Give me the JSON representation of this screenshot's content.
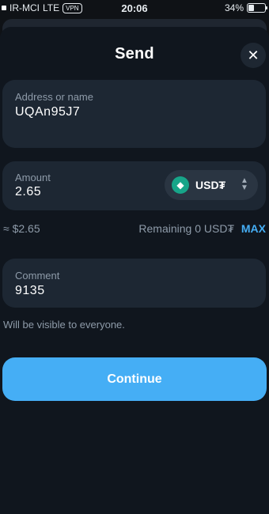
{
  "status_bar": {
    "carrier": "IR-MCI",
    "network": "LTE",
    "vpn": "VPN",
    "time": "20:06",
    "battery": "34%",
    "battery_level": 0.34
  },
  "header": {
    "title": "Send",
    "close_icon": "close-icon"
  },
  "address": {
    "label": "Address or name",
    "value": "UQAn95J7"
  },
  "amount": {
    "label": "Amount",
    "value": "2.65",
    "token": {
      "symbol": "USD₮",
      "icon": "tether-icon",
      "color": "#17a589"
    }
  },
  "info": {
    "approx": "≈ $2.65",
    "remaining": "Remaining 0 USD₮",
    "max": "MAX"
  },
  "comment": {
    "label": "Comment",
    "value": "9135",
    "hint": "Will be visible to everyone."
  },
  "actions": {
    "continue": "Continue"
  },
  "colors": {
    "accent": "#45aef5",
    "background": "#10161e",
    "field": "#1d2733"
  }
}
